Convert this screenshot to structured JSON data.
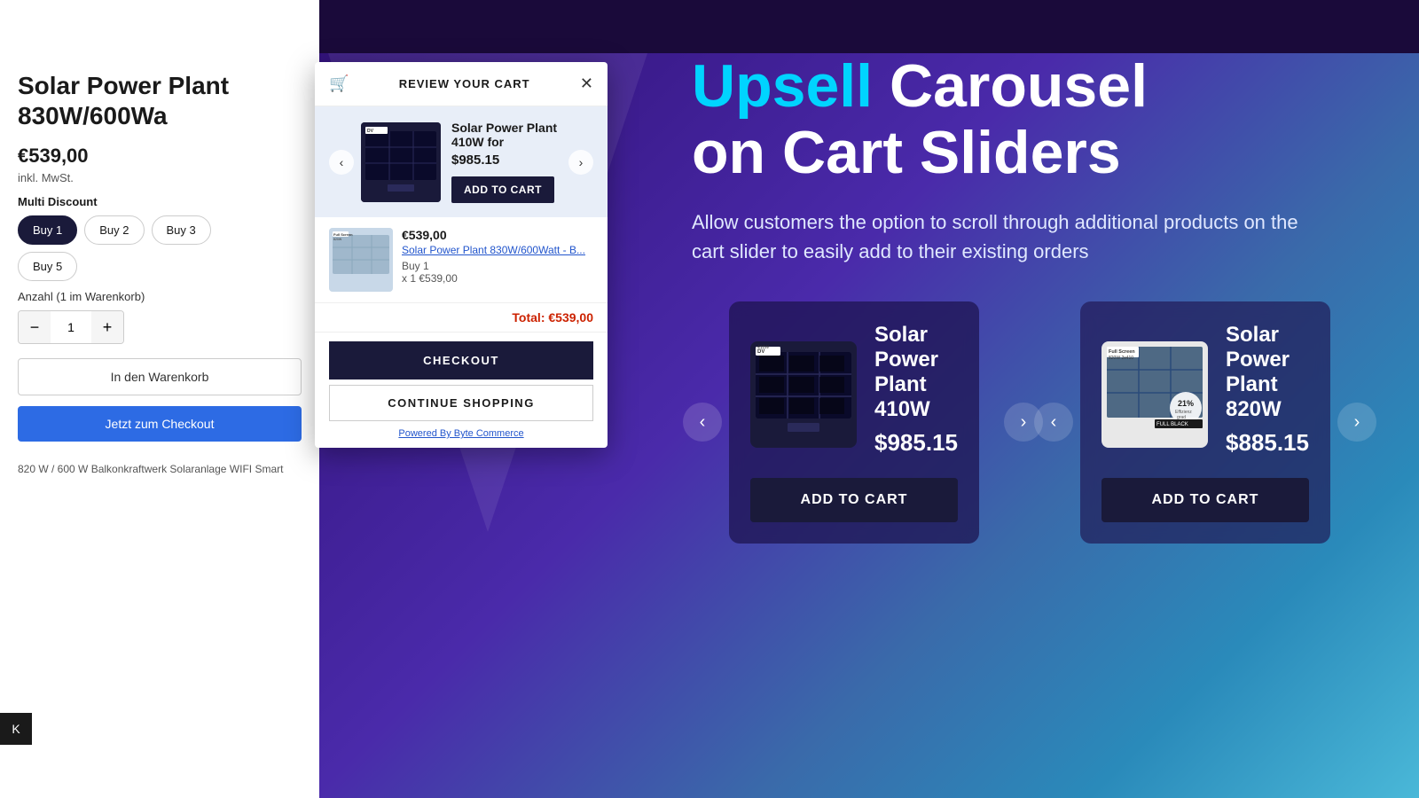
{
  "page": {
    "title": "Upsell Carousel on Cart Sliders"
  },
  "background": {
    "color": "#2a1a6a"
  },
  "product_page": {
    "title": "Solar Power Plant 830W/600Wa",
    "price": "€539,00",
    "tax_label": "inkl. MwSt.",
    "multi_discount_label": "Multi Discount",
    "discount_options": [
      "Buy 1",
      "Buy 2",
      "Buy 3",
      "Buy 5"
    ],
    "active_discount": "Buy 1",
    "qty_label": "Anzahl (1 im Warenkorb)",
    "qty_value": "1",
    "add_to_cart_label": "In den Warenkorb",
    "checkout_label": "Jetzt zum Checkout",
    "description": "820 W / 600 W Balkonkraftwerk Solaranlage WIFI Smart",
    "back_label": "K"
  },
  "cart_modal": {
    "title": "REVIEW YOUR CART",
    "close_label": "✕",
    "carousel": {
      "product_name": "Solar Power Plant 410W for",
      "product_price": "$985.15",
      "add_to_cart_label": "ADD TO CART"
    },
    "cart_item": {
      "price": "€539,00",
      "name": "Solar Power Plant 830W/600Watt - B...",
      "qty_label": "Buy 1",
      "qty": "x 1",
      "subtotal": "€539,00"
    },
    "total_label": "Total:",
    "total_value": "€539,00",
    "checkout_label": "CHECKOUT",
    "continue_label": "CONTINUE SHOPPING",
    "powered_by": "Powered By Byte Commerce"
  },
  "hero": {
    "title_part1": "Upsell",
    "title_part2": " Carousel",
    "title_line2": "on Cart Sliders",
    "subtitle": "Allow customers the option to scroll through additional products on the cart slider to easily add to their existing orders"
  },
  "upsell_carousel": {
    "card1": {
      "product_name": "Solar Power Plant 410W",
      "product_price": "$985.15",
      "add_to_cart_label": "ADD TO CART"
    },
    "card2": {
      "product_name": "Solar Power Plant 820W",
      "product_price": "$885.15",
      "add_to_cart_label": "ADD TO CART",
      "efficiency_label": "21%",
      "efficiency_sublabel": "Effizienzgrad"
    }
  }
}
